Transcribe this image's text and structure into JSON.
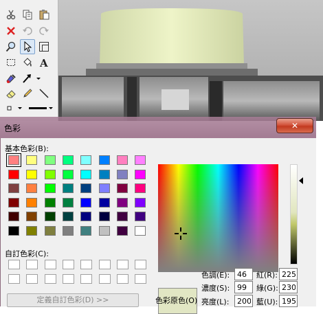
{
  "dialog": {
    "title": "色彩",
    "close_glyph": "✕",
    "basic_colors_label": "基本色彩(B):",
    "custom_colors_label": "自訂色彩(C):",
    "define_custom_label": "定義自訂色彩(D) >>",
    "preview_label": "色彩原色(O)",
    "basic_colors": [
      "#ff8080",
      "#ffff80",
      "#80ff80",
      "#00ff80",
      "#80ffff",
      "#0080ff",
      "#ff80c0",
      "#ff80ff",
      "#ff0000",
      "#ffff00",
      "#80ff00",
      "#00ff40",
      "#00ffff",
      "#0080c0",
      "#8080c0",
      "#ff00ff",
      "#804040",
      "#ff8040",
      "#00ff00",
      "#008080",
      "#004080",
      "#8080ff",
      "#800040",
      "#ff0080",
      "#800000",
      "#ff8000",
      "#008000",
      "#008040",
      "#0000ff",
      "#0000a0",
      "#800080",
      "#8000ff",
      "#400000",
      "#804000",
      "#004000",
      "#004040",
      "#000080",
      "#000040",
      "#400040",
      "#400080",
      "#000000",
      "#808000",
      "#808040",
      "#808080",
      "#408080",
      "#c0c0c0",
      "#400040",
      "#ffffff"
    ],
    "selected_index": 0,
    "fields": {
      "hue": {
        "label": "色調(E):",
        "value": "46"
      },
      "saturation": {
        "label": "濃度(S):",
        "value": "99"
      },
      "luminance": {
        "label": "亮度(L):",
        "value": "200"
      },
      "red": {
        "label": "紅(R):",
        "value": "225"
      },
      "green": {
        "label": "綠(G):",
        "value": "230"
      },
      "blue": {
        "label": "藍(U):",
        "value": "195"
      }
    },
    "current_color": "#e1e6c3"
  },
  "toolbox": {
    "icons": [
      "cut-icon",
      "copy-icon",
      "paste-icon",
      "delete-icon",
      "undo-icon",
      "redo-icon",
      "zoom-icon",
      "select-icon",
      "crop-icon",
      "rect-select-icon",
      "fill-icon",
      "text-icon",
      "color-picker-icon",
      "arrow-icon",
      "eraser-icon",
      "pencil-icon",
      "line-icon"
    ]
  }
}
